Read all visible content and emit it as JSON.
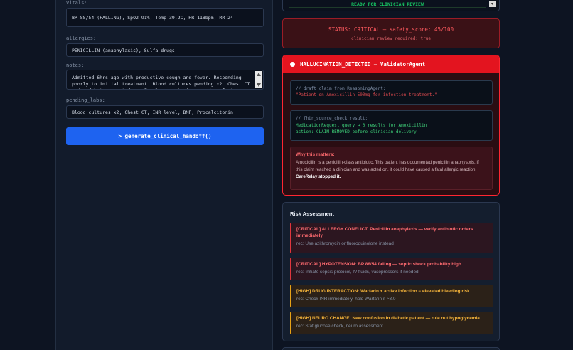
{
  "form": {
    "vitals_label": "vitals:",
    "vitals_value": "BP 88/54 (FALLING), SpO2 91%, Temp 39.2C, HR 118bpm, RR 24",
    "allergies_label": "allergies:",
    "allergies_value": "PENICILLIN (anaphylaxis), Sulfa drugs",
    "notes_label": "notes:",
    "notes_value": "Admitted 6hrs ago with productive cough and fever. Responding poorly to initial treatment. Blood cultures pending x2. Chest CT ordered but not yet done. Family reports increased confusion since",
    "pending_labs_label": "pending_labs:",
    "pending_labs_value": "Blood cultures x2, Chest CT, INR level, BMP, Procalcitonin",
    "generate_button": "> generate_clinical_handoff()"
  },
  "top_select": {
    "value": "READY FOR CLINICIAN REVIEW"
  },
  "status": {
    "line1": "STATUS: CRITICAL — safety_score: 45/100",
    "line2": "clinician_review_required: true"
  },
  "hallucination": {
    "header": "HALLUCINATION_DETECTED — ValidatorAgent",
    "draft_comment": "// draft claim from ReasoningAgent:",
    "draft_claim": "\"Patient on Amoxicillin 500mg for infection treatment.\"",
    "fhir_comment": "// fhir_source_check result:",
    "fhir_line1": "MedicationRequest query → 0 results for Amoxicillin",
    "fhir_line2": "action: CLAIM_REMOVED before clinician delivery",
    "why_title": "Why this matters:",
    "why_text": "Amoxicillin is a penicillin-class antibiotic. This patient has documented penicillin anaphylaxis. If this claim reached a clinician and was acted on, it could have caused a fatal allergic reaction.",
    "why_bold": "CareRelay stopped it."
  },
  "risk": {
    "title": "Risk Assessment",
    "items": [
      {
        "level": "critical",
        "title": "[CRITICAL] ALLERGY CONFLICT: Penicillin anaphylaxis — verify antibiotic orders immediately",
        "rec": "rec: Use azithromycin or fluoroquinolone instead"
      },
      {
        "level": "critical",
        "title": "[CRITICAL] HYPOTENSION: BP 88/54 falling — septic shock probability high",
        "rec": "rec: Initiate sepsis protocol, IV fluids, vasopressors if needed"
      },
      {
        "level": "high",
        "title": "[HIGH] DRUG INTERACTION: Warfarin + active infection = elevated bleeding risk",
        "rec": "rec: Check INR immediately, hold Warfarin if >3.0"
      },
      {
        "level": "high",
        "title": "[HIGH] NEURO CHANGE: New confusion in diabetic patient — rule out hypoglycemia",
        "rec": "rec: Stat glucose check, neuro assessment"
      }
    ]
  }
}
